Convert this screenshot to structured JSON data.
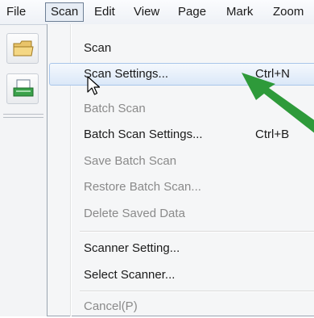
{
  "menubar": {
    "items": [
      {
        "label": "File"
      },
      {
        "label": "Scan",
        "active": true
      },
      {
        "label": "Edit"
      },
      {
        "label": "View"
      },
      {
        "label": "Page"
      },
      {
        "label": "Mark"
      },
      {
        "label": "Zoom"
      }
    ]
  },
  "scan_menu": {
    "items": [
      {
        "label": "Scan",
        "shortcut": "",
        "enabled": true
      },
      {
        "label": "Scan Settings...",
        "shortcut": "Ctrl+N",
        "enabled": true,
        "highlighted": true
      },
      {
        "label": "Batch Scan",
        "shortcut": "",
        "enabled": false
      },
      {
        "label": "Batch Scan Settings...",
        "shortcut": "Ctrl+B",
        "enabled": true
      },
      {
        "label": "Save Batch Scan",
        "shortcut": "",
        "enabled": false
      },
      {
        "label": "Restore Batch Scan...",
        "shortcut": "",
        "enabled": false
      },
      {
        "label": "Delete Saved Data",
        "shortcut": "",
        "enabled": false
      },
      {
        "label": "Scanner Setting...",
        "shortcut": "",
        "enabled": true
      },
      {
        "label": "Select Scanner...",
        "shortcut": "",
        "enabled": true
      },
      {
        "label": "Cancel(P)",
        "shortcut": "",
        "enabled": false
      }
    ]
  },
  "toolbar": {
    "icons": [
      "open-folder-icon",
      "scan-document-icon"
    ]
  },
  "annotation": {
    "color": "#2e9a3a",
    "icon": "green-pointer-arrow"
  }
}
